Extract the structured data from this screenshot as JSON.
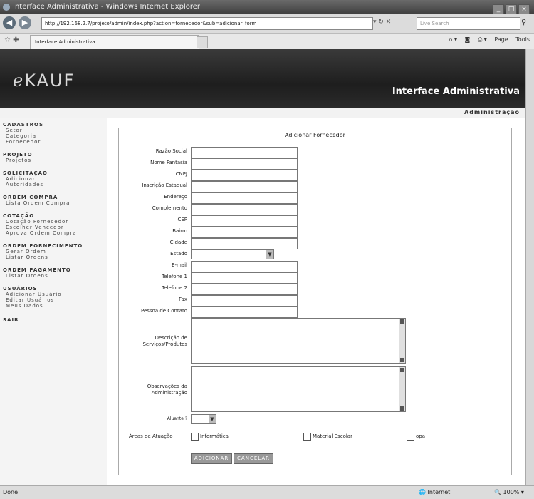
{
  "window": {
    "title": "Interface Administrativa - Windows Internet Explorer"
  },
  "browser": {
    "back_icon": "back-arrow-icon",
    "forward_icon": "forward-arrow-icon",
    "url": "http://192.168.2.7/projeto/admin/index.php?action=fornecedor&sub=adicionar_form",
    "search_placeholder": "Live Search",
    "tab_title": "Interface Administrativa",
    "cmd_page": "Page",
    "cmd_tools": "Tools"
  },
  "site": {
    "logo_prefix": "e",
    "logo_rest": "KAUF",
    "banner_title": "Interface Administrativa",
    "section_label": "Administração"
  },
  "sidebar": {
    "groups": [
      {
        "head": "CADASTROS",
        "items": [
          "Setor",
          "Categoria",
          "Fornecedor"
        ]
      },
      {
        "head": "PROJETO",
        "items": [
          "Projetos"
        ]
      },
      {
        "head": "SOLICITAÇÃO",
        "items": [
          "Adicionar",
          "Autoridades"
        ]
      },
      {
        "head": "ORDEM COMPRA",
        "items": [
          "Lista Ordem Compra"
        ]
      },
      {
        "head": "COTAÇÃO",
        "items": [
          "Cotação Fornecedor",
          "Escolher Vencedor",
          "Aprova Ordem Compra"
        ]
      },
      {
        "head": "ORDEM FORNECIMENTO",
        "items": [
          "Gerar Ordem",
          "Listar Ordens"
        ]
      },
      {
        "head": "ORDEM PAGAMENTO",
        "items": [
          "Listar Ordens"
        ]
      },
      {
        "head": "USUÁRIOS",
        "items": [
          "Adicionar Usuário",
          "Editar Usuários",
          "Meus Dados"
        ]
      },
      {
        "head": "SAIR",
        "items": []
      }
    ]
  },
  "form": {
    "title": "Adicionar Fornecedor",
    "fields": {
      "razao_social": {
        "label": "Razão Social",
        "value": ""
      },
      "nome_fantasia": {
        "label": "Nome Fantasia",
        "value": ""
      },
      "cnpj": {
        "label": "CNPJ",
        "value": ""
      },
      "inscricao_estadual": {
        "label": "Inscrição Estadual",
        "value": ""
      },
      "endereco": {
        "label": "Endereço",
        "value": ""
      },
      "complemento": {
        "label": "Complemento",
        "value": ""
      },
      "cep": {
        "label": "CEP",
        "value": ""
      },
      "bairro": {
        "label": "Bairro",
        "value": ""
      },
      "cidade": {
        "label": "Cidade",
        "value": ""
      },
      "estado": {
        "label": "Estado",
        "value": ""
      },
      "email": {
        "label": "E-mail",
        "value": ""
      },
      "telefone1": {
        "label": "Telefone 1",
        "value": ""
      },
      "telefone2": {
        "label": "Telefone 2",
        "value": ""
      },
      "fax": {
        "label": "Fax",
        "value": ""
      },
      "pessoa_contato": {
        "label": "Pessoa de Contato",
        "value": ""
      }
    },
    "descricao_label": "Descrição de Serviços/Produtos",
    "observacoes_label": "Observações da Administração",
    "ativo_label": "Aluante ?",
    "areas_label": "Áreas de Atuação",
    "areas": [
      "Informática",
      "Material Escolar",
      "opa"
    ],
    "submit_label": "ADICIONAR",
    "cancel_label": "CANCELAR"
  },
  "status": {
    "left": "Done",
    "zone": "Internet",
    "zoom": "100%"
  }
}
